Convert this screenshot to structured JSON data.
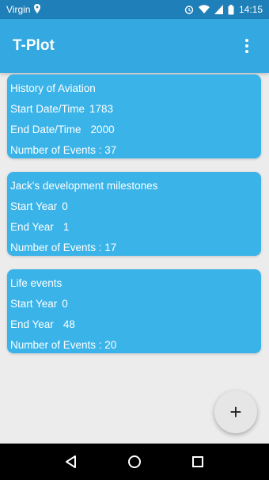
{
  "status_bar": {
    "carrier": "Virgin",
    "time": "14:15",
    "icons": [
      "location-icon",
      "alarm-icon",
      "wifi-icon",
      "signal-icon",
      "battery-icon"
    ]
  },
  "app_bar": {
    "title": "T-Plot",
    "menu_icon": "overflow-menu-icon"
  },
  "timelines": [
    {
      "title": "History of Aviation",
      "start_label": "Start Date/Time",
      "start_value": "1783",
      "end_label": "End Date/Time",
      "end_value": "2000",
      "events": "Number of Events : 37"
    },
    {
      "title": "Jack's development milestones",
      "start_label": "Start Year",
      "start_value": "0",
      "end_label": "End Year",
      "end_value": "1",
      "events": "Number of Events : 17"
    },
    {
      "title": "Life events",
      "start_label": "Start Year",
      "start_value": "0",
      "end_label": "End Year",
      "end_value": "48",
      "events": "Number of Events : 20"
    }
  ],
  "fab": {
    "label": "+"
  },
  "colors": {
    "status_bar": "#1f7fb8",
    "app_bar": "#34a8e0",
    "card": "#3ab3e8",
    "background": "#ececec"
  }
}
